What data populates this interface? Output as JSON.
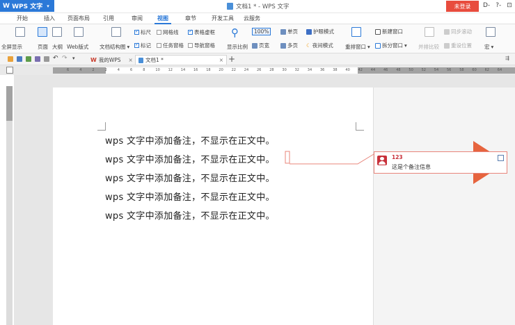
{
  "titlebar": {
    "app_name": "WPS 文字",
    "document_title": "文档1 * - WPS 文字",
    "login_label": "未登录",
    "right_controls": [
      "D-",
      "?-",
      "⊡"
    ]
  },
  "menu": {
    "tabs": [
      "开始",
      "插入",
      "页面布局",
      "引用",
      "审阅",
      "视图",
      "章节",
      "开发工具",
      "云服务"
    ],
    "active_tab": "视图"
  },
  "ribbon": {
    "fullscreen": "全屏显示",
    "page_view": "页面",
    "outline": "大纲",
    "web_layout": "Web版式",
    "doc_structure": "文档结构图",
    "ruler": "标尺",
    "gridlines": "网格线",
    "table_gridlines": "表格虚框",
    "marks": "标记",
    "task_pane": "任务窗格",
    "nav_pane": "导航窗格",
    "zoom": "显示比例",
    "zoom_100": "100%",
    "single_page": "单页",
    "page_width": "页宽",
    "multi_page": "多页",
    "eye_mode": "护眼模式",
    "night_mode": "夜间模式",
    "rearrange": "重排窗口",
    "new_window": "新建窗口",
    "split_window": "拆分窗口",
    "side_by_side": "并排比较",
    "sync_scroll": "同步滚动",
    "reset_position": "重设位置",
    "macro": "宏"
  },
  "doc_tabs": [
    {
      "label": "我的WPS"
    },
    {
      "label": "文档1 *"
    }
  ],
  "ruler_numbers": [
    "6",
    "4",
    "2",
    "2",
    "4",
    "6",
    "8",
    "10",
    "12",
    "14",
    "16",
    "18",
    "20",
    "22",
    "24",
    "26",
    "28",
    "30",
    "32",
    "34",
    "36",
    "38",
    "40",
    "42",
    "44",
    "46",
    "48",
    "50",
    "52",
    "54",
    "56",
    "58",
    "60",
    "62",
    "64"
  ],
  "document": {
    "lines": [
      "wps 文字中添加备注，不显示在正文中。",
      "wps 文字中添加备注，不显示在正文中。",
      "wps 文字中添加备注，不显示在正文中。",
      "wps 文字中添加备注，不显示在正文中。",
      "wps 文字中添加备注，不显示在正文中。"
    ]
  },
  "comment": {
    "user": "123",
    "text": "这是个备注信息"
  },
  "colors": {
    "accent": "#2b79d8",
    "login": "#e84c3d",
    "arrow": "#e4572e",
    "comment_border": "#e8847a"
  }
}
